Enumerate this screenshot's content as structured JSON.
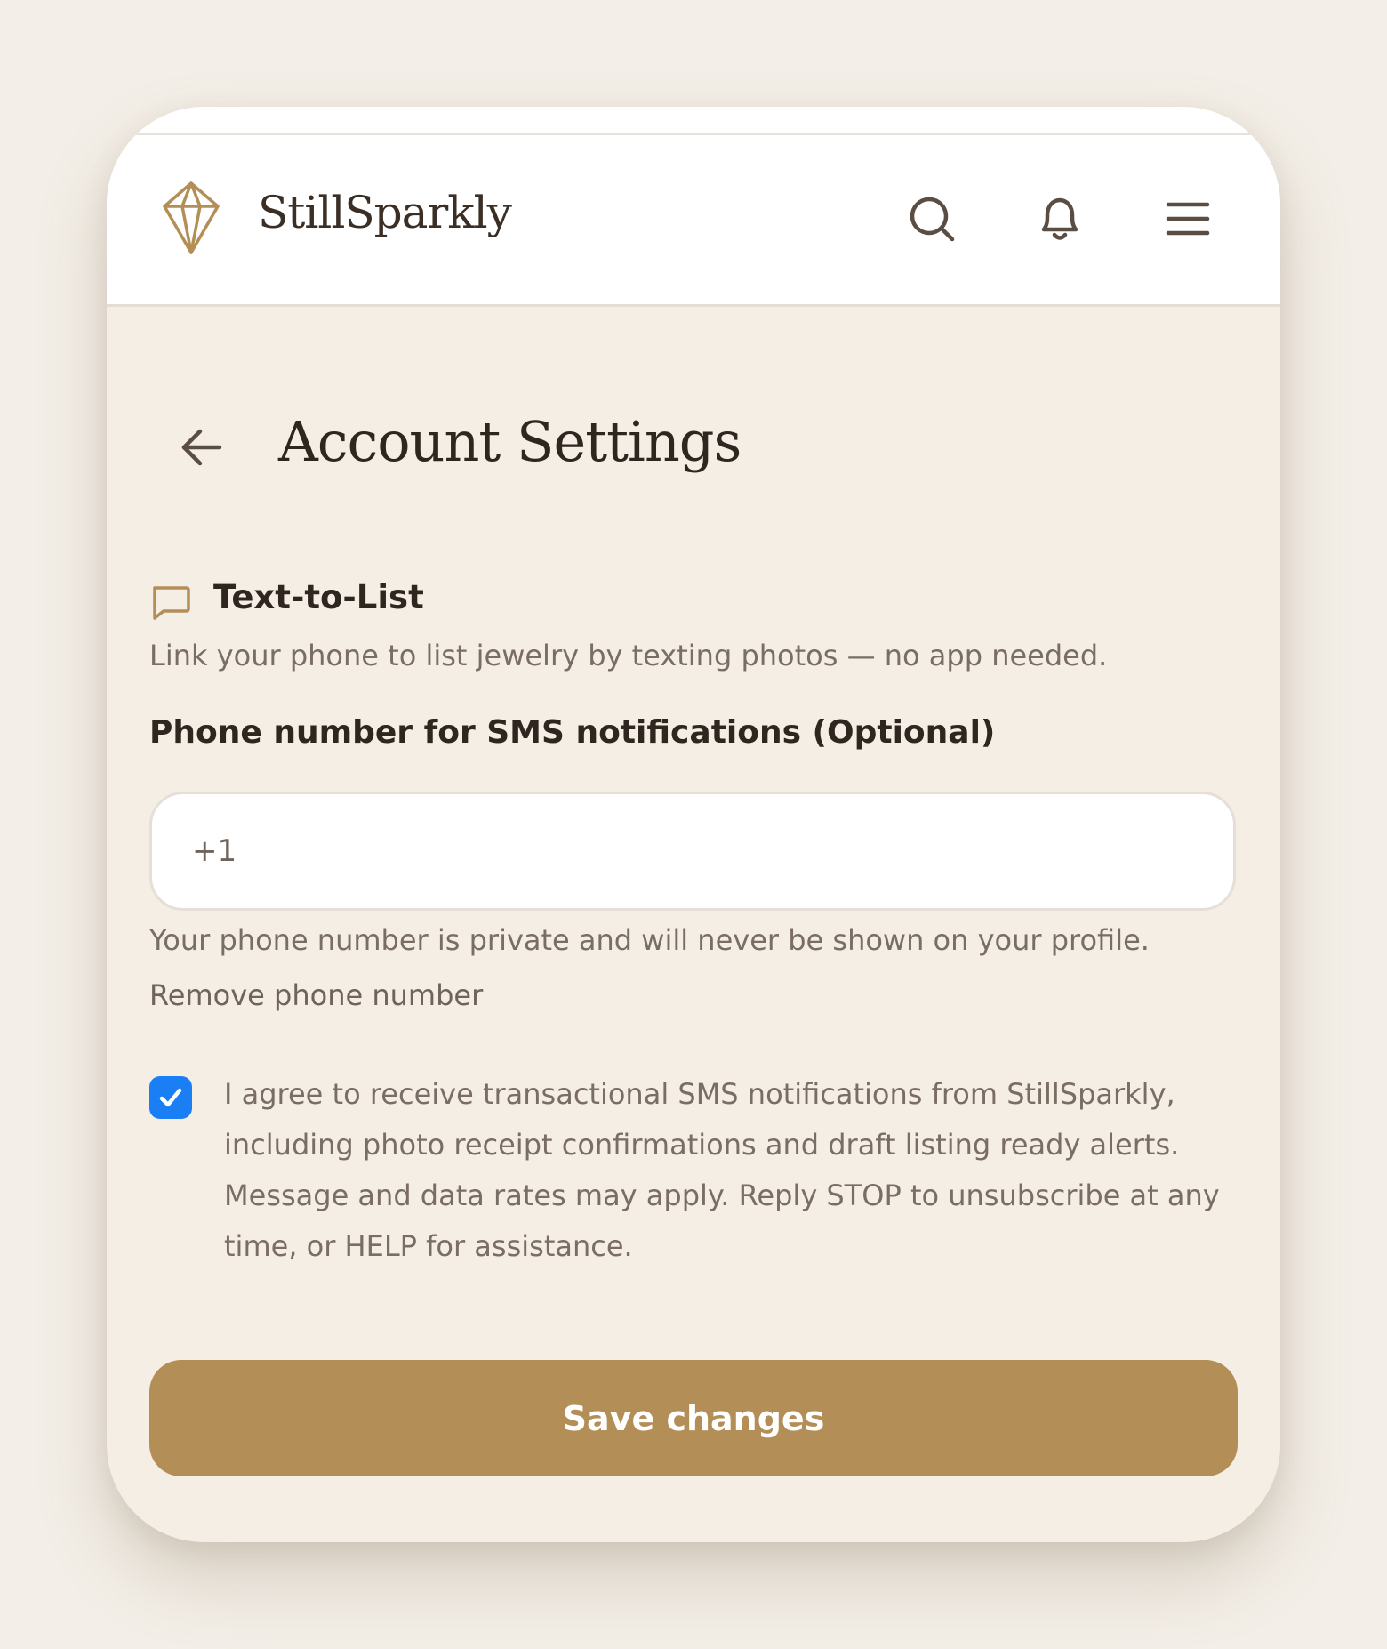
{
  "header": {
    "brand": "StillSparkly",
    "icons": [
      "diamond-logo",
      "search-icon",
      "bell-icon",
      "menu-icon"
    ]
  },
  "page": {
    "title": "Account Settings"
  },
  "section": {
    "title": "Text-to-List",
    "description": "Link your phone to list jewelry by texting photos — no app needed."
  },
  "phone_field": {
    "label": "Phone number for SMS notifications (Optional)",
    "value": "+1",
    "note": "Your phone number is private and will never be shown on your profile.",
    "remove_link": "Remove phone number"
  },
  "consent": {
    "checked": true,
    "text": "I agree to receive transactional SMS notifications from StillSparkly, including photo receipt confirmations and draft listing ready alerts. Message and data rates may apply. Reply STOP to unsubscribe at any time, or HELP for assistance."
  },
  "actions": {
    "save_label": "Save changes"
  },
  "colors": {
    "accent": "#b38e57",
    "background": "#f4eee5",
    "checkbox": "#1a7ef5",
    "text_dark": "#2f261f",
    "text_muted": "#7a6d63"
  }
}
